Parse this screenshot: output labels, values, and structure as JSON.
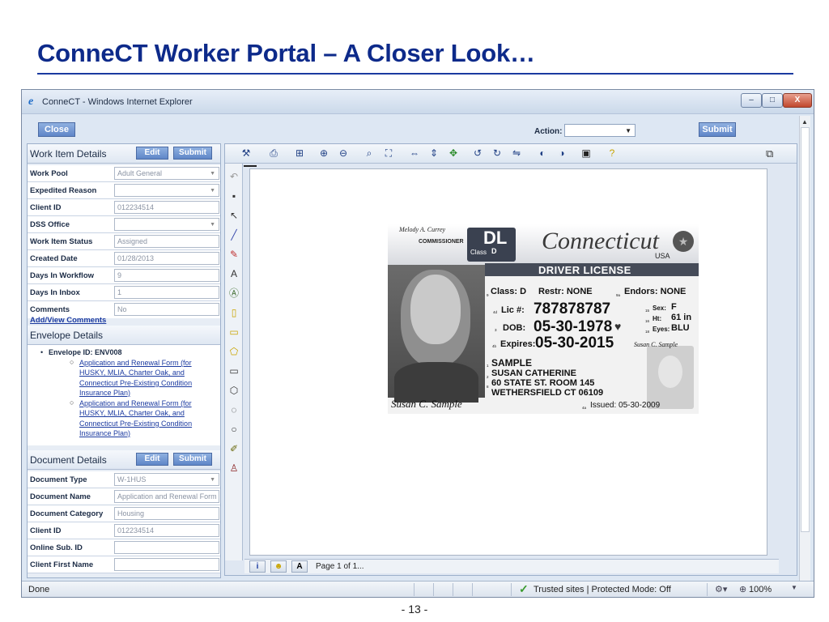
{
  "slide": {
    "title": "ConneCT Worker Portal – A Closer Look…",
    "page_number": "- 13 -"
  },
  "window": {
    "title": "ConneCT - Windows Internet Explorer",
    "minimize": "–",
    "maximize": "□",
    "close": "X"
  },
  "topbar": {
    "close_label": "Close",
    "action_label": "Action:",
    "action_value": "",
    "submit_label": "Submit"
  },
  "work_item": {
    "header": "Work Item Details",
    "edit_label": "Edit",
    "submit_label": "Submit",
    "fields": [
      {
        "label": "Work Pool",
        "value": "Adult General"
      },
      {
        "label": "Expedited Reason",
        "value": ""
      },
      {
        "label": "Client ID",
        "value": "012234514"
      },
      {
        "label": "DSS Office",
        "value": ""
      },
      {
        "label": "Work Item Status",
        "value": "Assigned"
      },
      {
        "label": "Created Date",
        "value": "01/28/2013"
      },
      {
        "label": "Days In Workflow",
        "value": "9"
      },
      {
        "label": "Days In Inbox",
        "value": "1"
      },
      {
        "label": "Comments",
        "value": "No"
      }
    ],
    "comments_link": "Add/View Comments"
  },
  "envelope": {
    "header": "Envelope Details",
    "id_label": "Envelope ID: ENV008",
    "documents": [
      "Application and Renewal Form (for HUSKY, MLIA, Charter Oak, and Connecticut Pre-Existing Condition Insurance Plan)",
      "Application and Renewal Form (for HUSKY, MLIA, Charter Oak, and Connecticut Pre-Existing Condition Insurance Plan)"
    ]
  },
  "document": {
    "header": "Document Details",
    "edit_label": "Edit",
    "submit_label": "Submit",
    "fields": [
      {
        "label": "Document Type",
        "value": "W-1HUS"
      },
      {
        "label": "Document Name",
        "value": "Application and Renewal Form"
      },
      {
        "label": "Document Category",
        "value": "Housing"
      },
      {
        "label": "Client ID",
        "value": "012234514"
      },
      {
        "label": "Online Sub. ID",
        "value": ""
      },
      {
        "label": "Client First Name",
        "value": ""
      }
    ]
  },
  "viewer": {
    "page_label": "Page 1 of 1...",
    "info_btn": "i",
    "annot_btn": "A"
  },
  "license": {
    "signature_top": "Melody A. Currey",
    "commissioner": "COMMISSIONER",
    "dl": "DL",
    "class_label": "Class",
    "class_value": "D",
    "state": "Connecticut",
    "usa": "USA",
    "driver_license": "DRIVER LICENSE",
    "f9": "9",
    "class_line": "Class: D",
    "restr": "Restr: NONE",
    "f9a": "9a",
    "endors": "Endors: NONE",
    "f4d": "4d",
    "lic_label": "Lic #:",
    "lic_number": "787878787",
    "f15": "15",
    "sex_label": "Sex:",
    "sex": "F",
    "f16": "16",
    "ht_label": "Ht:",
    "ht": "61 in",
    "f18": "18",
    "eyes_label": "Eyes:",
    "eyes": "BLU",
    "f3": "3",
    "dob_label": "DOB:",
    "dob": "05-30-1978",
    "f4b": "4b",
    "exp_label": "Expires:",
    "expires": "05-30-2015",
    "f1": "1",
    "last_name": "SAMPLE",
    "f2": "2",
    "first_name": "SUSAN CATHERINE",
    "f8": "8",
    "address1": "60 STATE ST. ROOM 145",
    "address2": "WETHERSFIELD CT 06109",
    "f4a": "4a",
    "issued": "Issued: 05-30-2009",
    "signature": "Susan C. Sample",
    "ghost_signature": "Susan C. Sample"
  },
  "statusbar": {
    "status": "Done",
    "zone": "Trusted sites | Protected Mode: Off",
    "zoom": "100%"
  }
}
